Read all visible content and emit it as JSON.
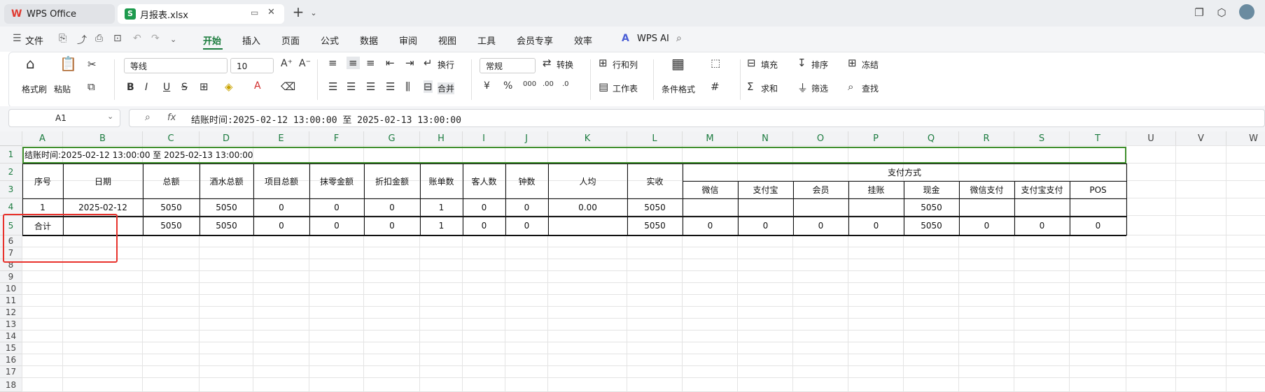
{
  "titlebar": {
    "app_tab": "WPS Office",
    "file_tab": "月报表.xlsx",
    "new_tab": "+"
  },
  "menu": {
    "file": "文件",
    "items": [
      "开始",
      "插入",
      "页面",
      "公式",
      "数据",
      "审阅",
      "视图",
      "工具",
      "会员专享",
      "效率"
    ],
    "ai": "WPS AI"
  },
  "ribbon": {
    "format_painter": "格式刷",
    "paste": "粘贴",
    "font_name": "等线",
    "font_size": "10",
    "wrap": "换行",
    "merge": "合并",
    "number_format": "常规",
    "convert": "转换",
    "rows_cols": "行和列",
    "worksheet": "工作表",
    "cond_format": "条件格式",
    "fill": "填充",
    "sort": "排序",
    "freeze": "冻结",
    "sum": "求和",
    "filter": "筛选",
    "find": "查找"
  },
  "formula_bar": {
    "cell_ref": "A1",
    "fx": "fx",
    "content": "结账时间:2025-02-12 13:00:00 至 2025-02-13 13:00:00"
  },
  "columns": [
    "A",
    "B",
    "C",
    "D",
    "E",
    "F",
    "G",
    "H",
    "I",
    "J",
    "K",
    "L",
    "M",
    "N",
    "O",
    "P",
    "Q",
    "R",
    "S",
    "T",
    "U",
    "V",
    "W"
  ],
  "rows": [
    "1",
    "2",
    "3",
    "4",
    "5",
    "6",
    "7",
    "8",
    "9",
    "10",
    "11",
    "12",
    "13",
    "14",
    "15",
    "16",
    "17",
    "18"
  ],
  "sheet": {
    "title": "结账时间:2025-02-12 13:00:00 至 2025-02-13 13:00:00",
    "headers": [
      "序号",
      "日期",
      "总额",
      "酒水总额",
      "项目总额",
      "抹零金额",
      "折扣金额",
      "账单数",
      "客人数",
      "钟数",
      "人均",
      "实收"
    ],
    "payment_group": "支付方式",
    "payment_headers": [
      "微信",
      "支付宝",
      "会员",
      "挂账",
      "现金",
      "微信支付",
      "支付宝支付",
      "POS"
    ],
    "row4": [
      "1",
      "2025-02-12",
      "5050",
      "5050",
      "0",
      "0",
      "0",
      "1",
      "0",
      "0",
      "0.00",
      "5050",
      "",
      "",
      "",
      "",
      "5050",
      "",
      "",
      ""
    ],
    "row5": [
      "合计",
      "",
      "5050",
      "5050",
      "0",
      "0",
      "0",
      "1",
      "0",
      "0",
      "",
      "5050",
      "0",
      "0",
      "0",
      "0",
      "5050",
      "0",
      "0",
      "0"
    ]
  }
}
